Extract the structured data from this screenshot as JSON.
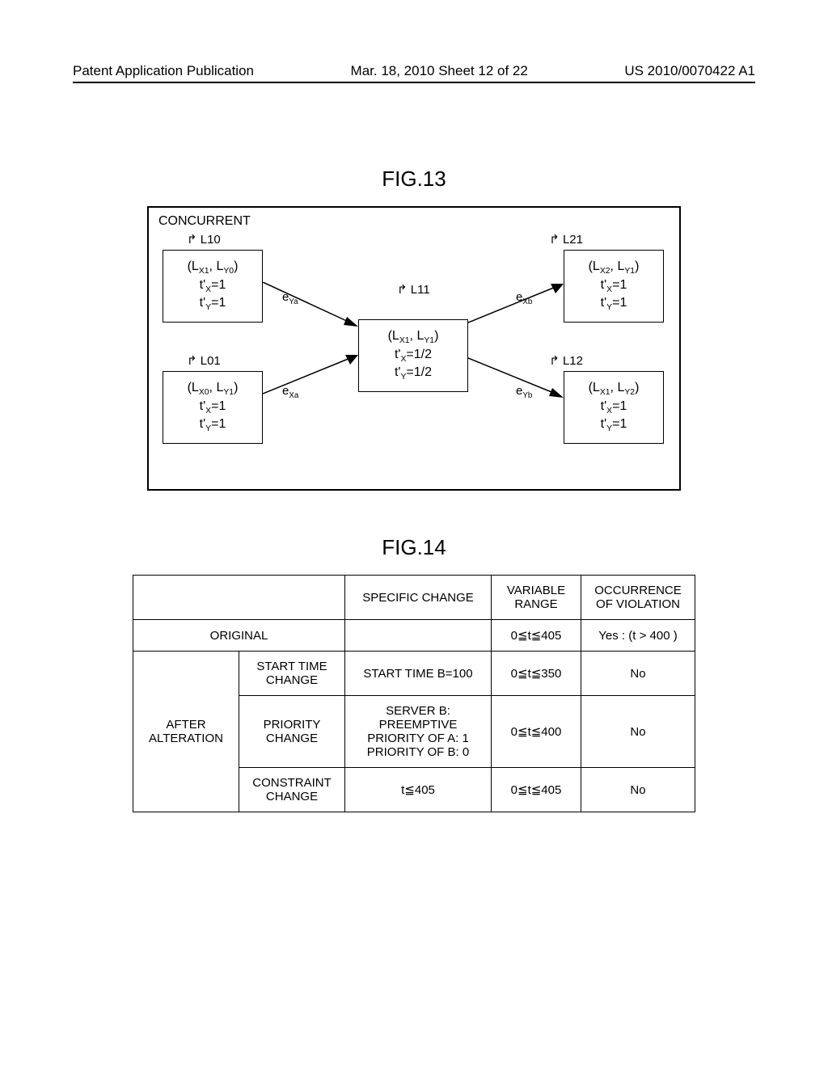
{
  "header": {
    "left": "Patent Application Publication",
    "mid": "Mar. 18, 2010  Sheet 12 of 22",
    "right": "US 2010/0070422 A1"
  },
  "fig13": {
    "title": "FIG.13",
    "concurrent": "CONCURRENT",
    "labels": {
      "L10": "L10",
      "L21": "L21",
      "L01": "L01",
      "L11": "L11",
      "L12": "L12"
    },
    "edges": {
      "eya": "eYa",
      "exa": "eXa",
      "exb": "eXb",
      "eyb": "eYb"
    },
    "nodes": {
      "n10": {
        "line1": "(L",
        "sub1": "X1",
        "line1b": ", L",
        "sub2": "Y0",
        "line1c": ")",
        "line2a": "t'",
        "line2sub": "X",
        "line2b": "=1",
        "line3a": "t'",
        "line3sub": "Y",
        "line3b": "=1"
      },
      "n01": {
        "line1": "(L",
        "sub1": "X0",
        "line1b": ", L",
        "sub2": "Y1",
        "line1c": ")",
        "line2a": "t'",
        "line2sub": "X",
        "line2b": "=1",
        "line3a": "t'",
        "line3sub": "Y",
        "line3b": "=1"
      },
      "n11": {
        "line1": "(L",
        "sub1": "X1",
        "line1b": ", L",
        "sub2": "Y1",
        "line1c": ")",
        "line2a": "t'",
        "line2sub": "X",
        "line2b": "=1/2",
        "line3a": "t'",
        "line3sub": "Y",
        "line3b": "=1/2"
      },
      "n21": {
        "line1": "(L",
        "sub1": "X2",
        "line1b": ", L",
        "sub2": "Y1",
        "line1c": ")",
        "line2a": "t'",
        "line2sub": "X",
        "line2b": "=1",
        "line3a": "t'",
        "line3sub": "Y",
        "line3b": "=1"
      },
      "n12": {
        "line1": "(L",
        "sub1": "X1",
        "line1b": ", L",
        "sub2": "Y2",
        "line1c": ")",
        "line2a": "t'",
        "line2sub": "X",
        "line2b": "=1",
        "line3a": "t'",
        "line3sub": "Y",
        "line3b": "=1"
      }
    }
  },
  "fig14": {
    "title": "FIG.14",
    "headers": {
      "specific_change": "SPECIFIC CHANGE",
      "variable_range": "VARIABLE\nRANGE",
      "occurrence": "OCCURRENCE\nOF VIOLATION"
    },
    "rows": {
      "original": {
        "label": "ORIGINAL",
        "specific": "",
        "range": "0≦t≦405",
        "occ": "Yes : (t > 400 )"
      },
      "after_label": "AFTER\nALTERATION",
      "start_time": {
        "label": "START TIME\nCHANGE",
        "specific": "START TIME B=100",
        "range": "0≦t≦350",
        "occ": "No"
      },
      "priority": {
        "label": "PRIORITY\nCHANGE",
        "specific": "SERVER B:\nPREEMPTIVE\nPRIORITY OF A: 1\nPRIORITY OF B: 0",
        "range": "0≦t≦400",
        "occ": "No"
      },
      "constraint": {
        "label": "CONSTRAINT\nCHANGE",
        "specific": "t≦405",
        "range": "0≦t≦405",
        "occ": "No"
      }
    }
  }
}
